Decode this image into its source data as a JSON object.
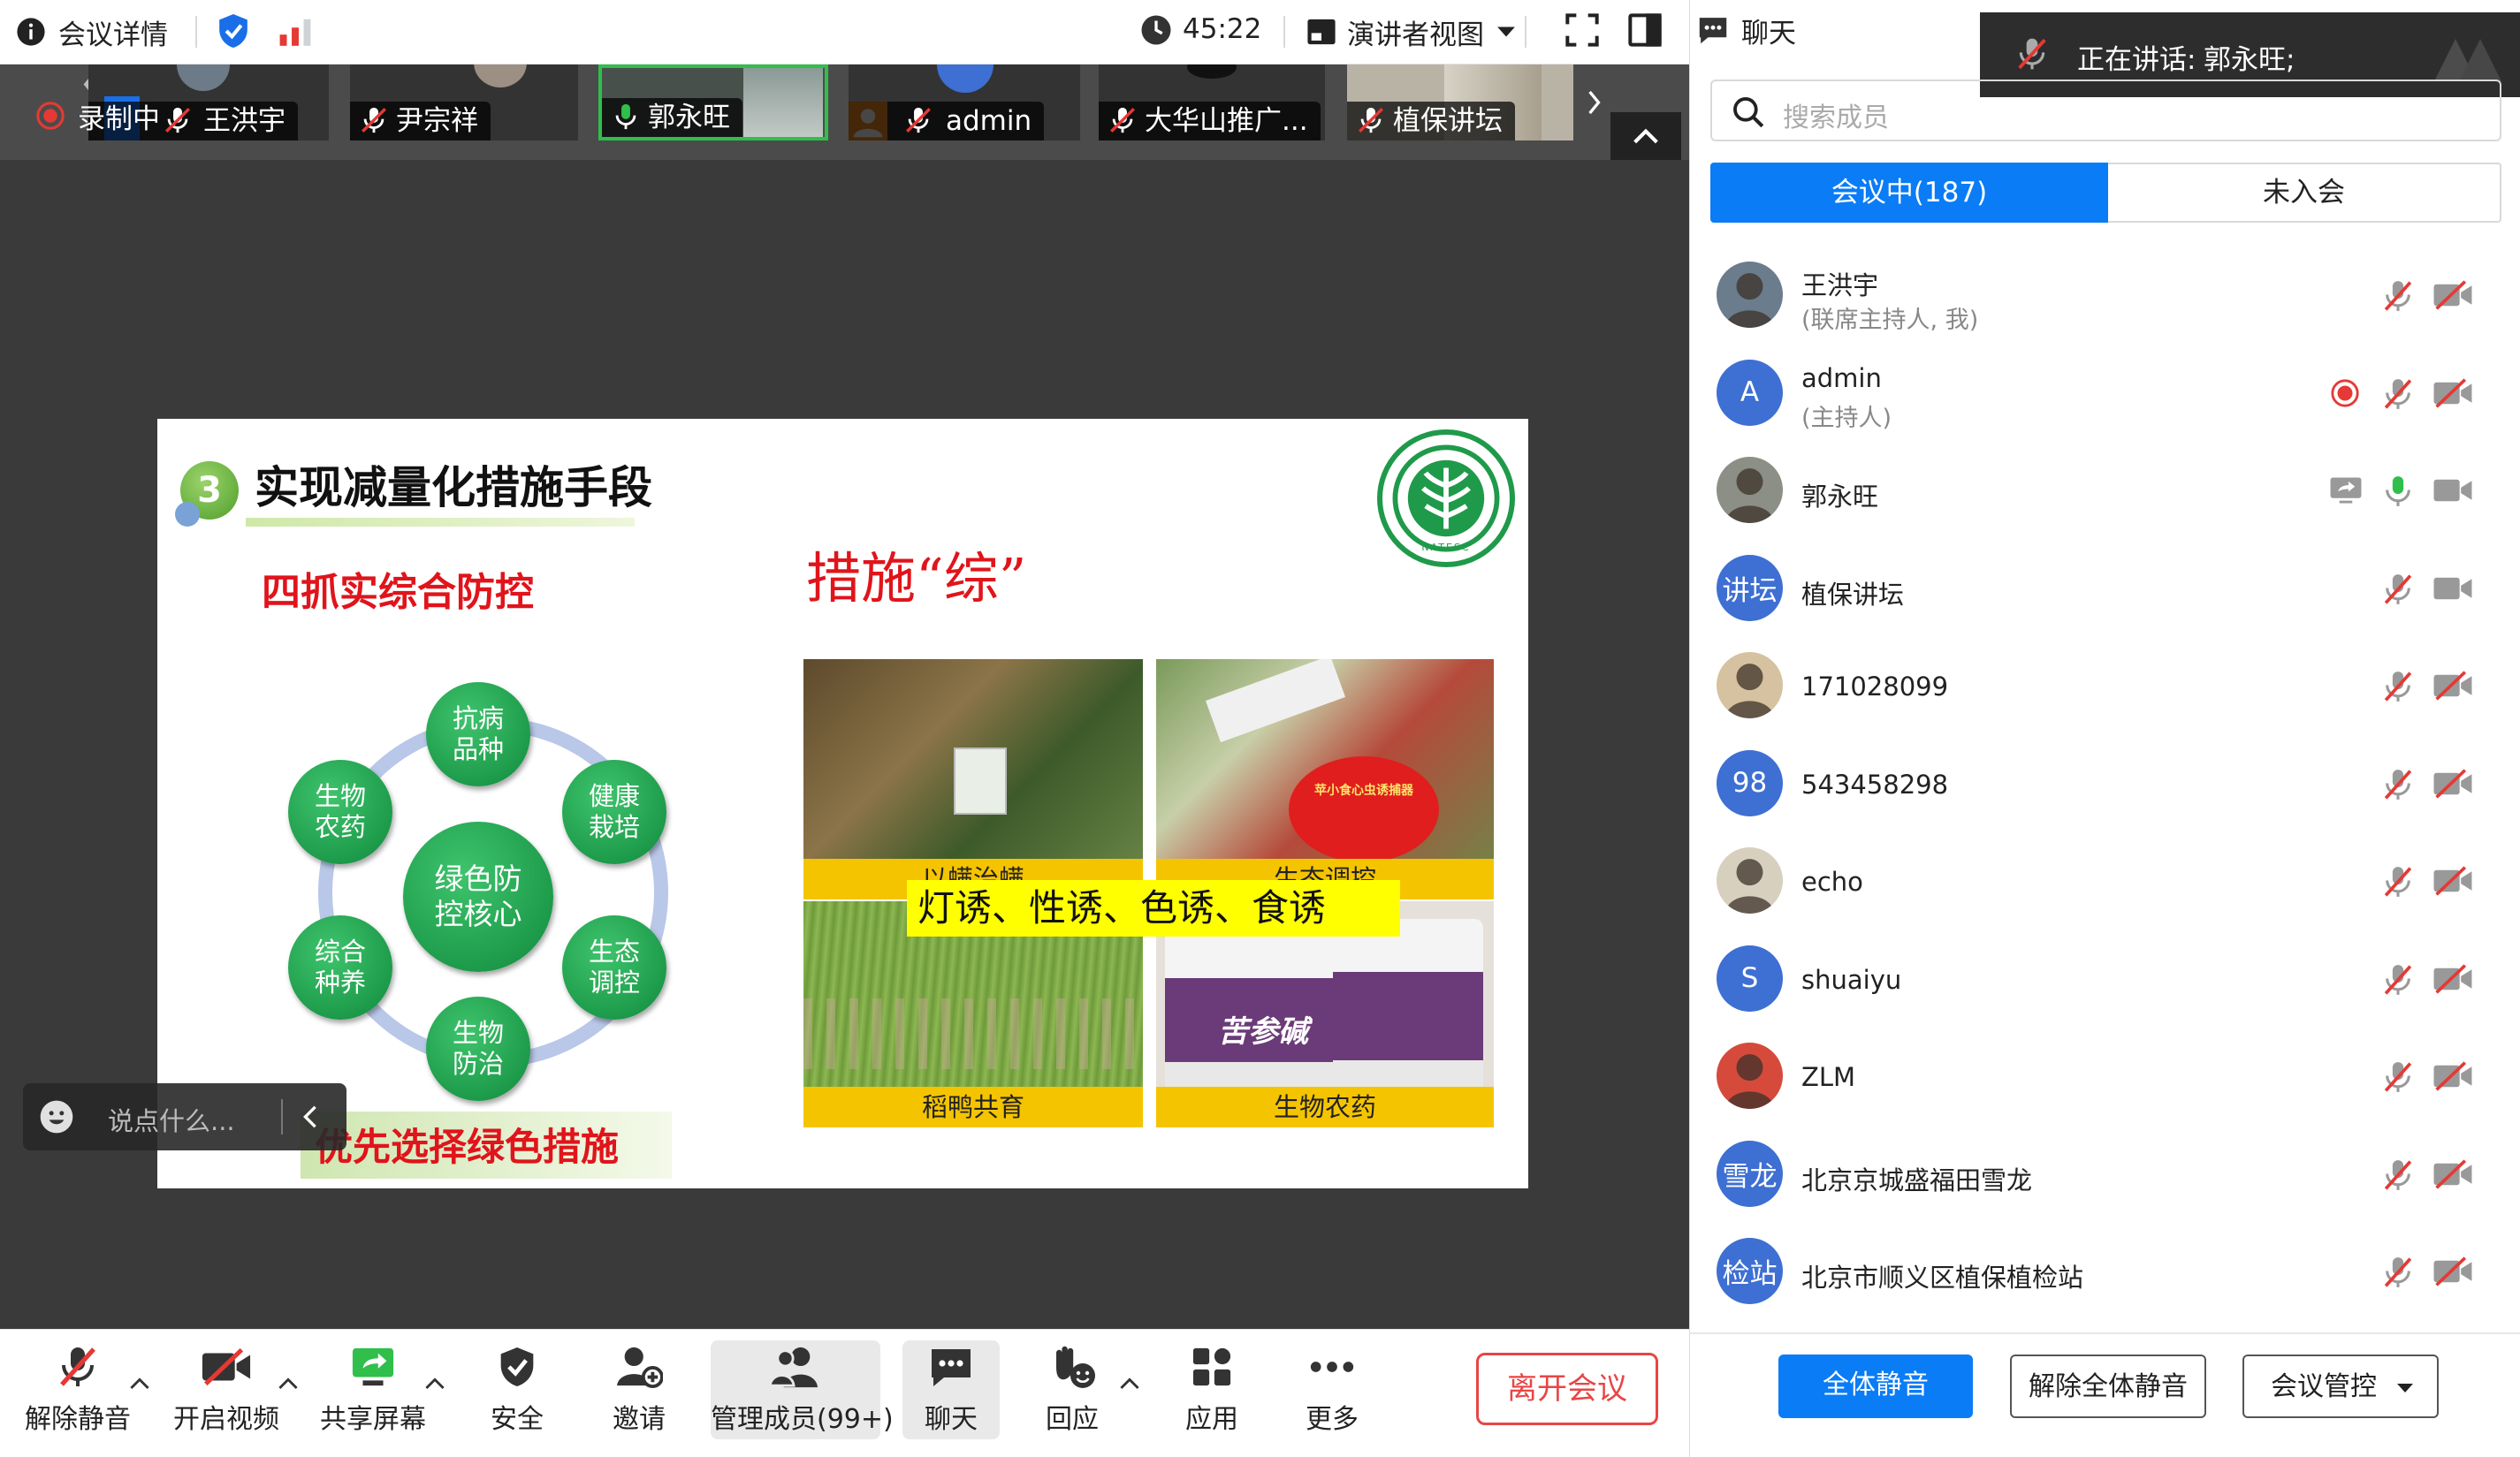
{
  "topbar": {
    "meeting_info": "会议详情",
    "timer": "45:22",
    "view_mode": "演讲者视图"
  },
  "gallery": {
    "recording": "录制中",
    "tiles": [
      {
        "name": "王洪宇"
      },
      {
        "name": "尹宗祥"
      },
      {
        "name": "郭永旺"
      },
      {
        "name": "admin"
      },
      {
        "name": "大华山推广..."
      },
      {
        "name": "植保讲坛"
      }
    ]
  },
  "slide": {
    "num": "3",
    "title": "实现减量化措施手段",
    "subtitle": "四抓实综合防控",
    "measure": "措施“综”",
    "center": [
      "绿色防",
      "控核心"
    ],
    "nodes": [
      [
        "抗病",
        "品种"
      ],
      [
        "健康",
        "栽培"
      ],
      [
        "生态",
        "调控"
      ],
      [
        "生物",
        "防治"
      ],
      [
        "综合",
        "种养"
      ],
      [
        "生物",
        "农药"
      ]
    ],
    "photos": [
      "以螨治螨",
      "生态调控",
      "稻鸭共育",
      "生物农药"
    ],
    "lure_banner": "灯诱、性诱、色诱、食诱",
    "footer": "优先选择绿色措施",
    "logo_text": "NATESC",
    "trap_label": "苹小食心虫诱捕器",
    "bottle_label": "苦参碱"
  },
  "chat_input": {
    "placeholder": "说点什么..."
  },
  "toolbar": {
    "unmute": "解除静音",
    "video": "开启视频",
    "share": "共享屏幕",
    "security": "安全",
    "invite": "邀请",
    "members": "管理成员(99+)",
    "chat": "聊天",
    "react": "回应",
    "apps": "应用",
    "more": "更多",
    "leave": "离开会议"
  },
  "panel": {
    "chat_title": "聊天",
    "speaking_label": "正在讲话:",
    "speaking_name": "郭永旺;",
    "search_placeholder": "搜索成员",
    "tab_in": "会议中(187)",
    "tab_out": "未入会",
    "members": [
      {
        "name": "王洪宇",
        "role": "(联席主持人, 我)",
        "avatar": "",
        "avatar_color": "#6b7c8c"
      },
      {
        "name": "admin",
        "role": "(主持人)",
        "avatar": "A",
        "avatar_color": "#3e6fd3"
      },
      {
        "name": "郭永旺",
        "role": "",
        "avatar": "",
        "avatar_color": "#8b8f86"
      },
      {
        "name": "植保讲坛",
        "role": "",
        "avatar": "讲坛",
        "avatar_color": "#3e6fd3"
      },
      {
        "name": "171028099",
        "role": "",
        "avatar": "",
        "avatar_color": "#d6c2a0"
      },
      {
        "name": "543458298",
        "role": "",
        "avatar": "98",
        "avatar_color": "#3e6fd3"
      },
      {
        "name": "echo",
        "role": "",
        "avatar": "",
        "avatar_color": "#d8d0bf"
      },
      {
        "name": "shuaiyu",
        "role": "",
        "avatar": "S",
        "avatar_color": "#3e6fd3"
      },
      {
        "name": "ZLM",
        "role": "",
        "avatar": "",
        "avatar_color": "#d64a3c"
      },
      {
        "name": "北京京城盛福田雪龙",
        "role": "",
        "avatar": "雪龙",
        "avatar_color": "#3e6fd3"
      },
      {
        "name": "北京市顺义区植保植检站",
        "role": "",
        "avatar": "检站",
        "avatar_color": "#3e6fd3"
      }
    ],
    "mute_all": "全体静音",
    "unmute_all": "解除全体静音",
    "manage": "会议管控"
  },
  "colors": {
    "accent": "#0a7cf5",
    "leave": "#e84545",
    "green": "#2fbf4a",
    "red": "#e53935"
  }
}
